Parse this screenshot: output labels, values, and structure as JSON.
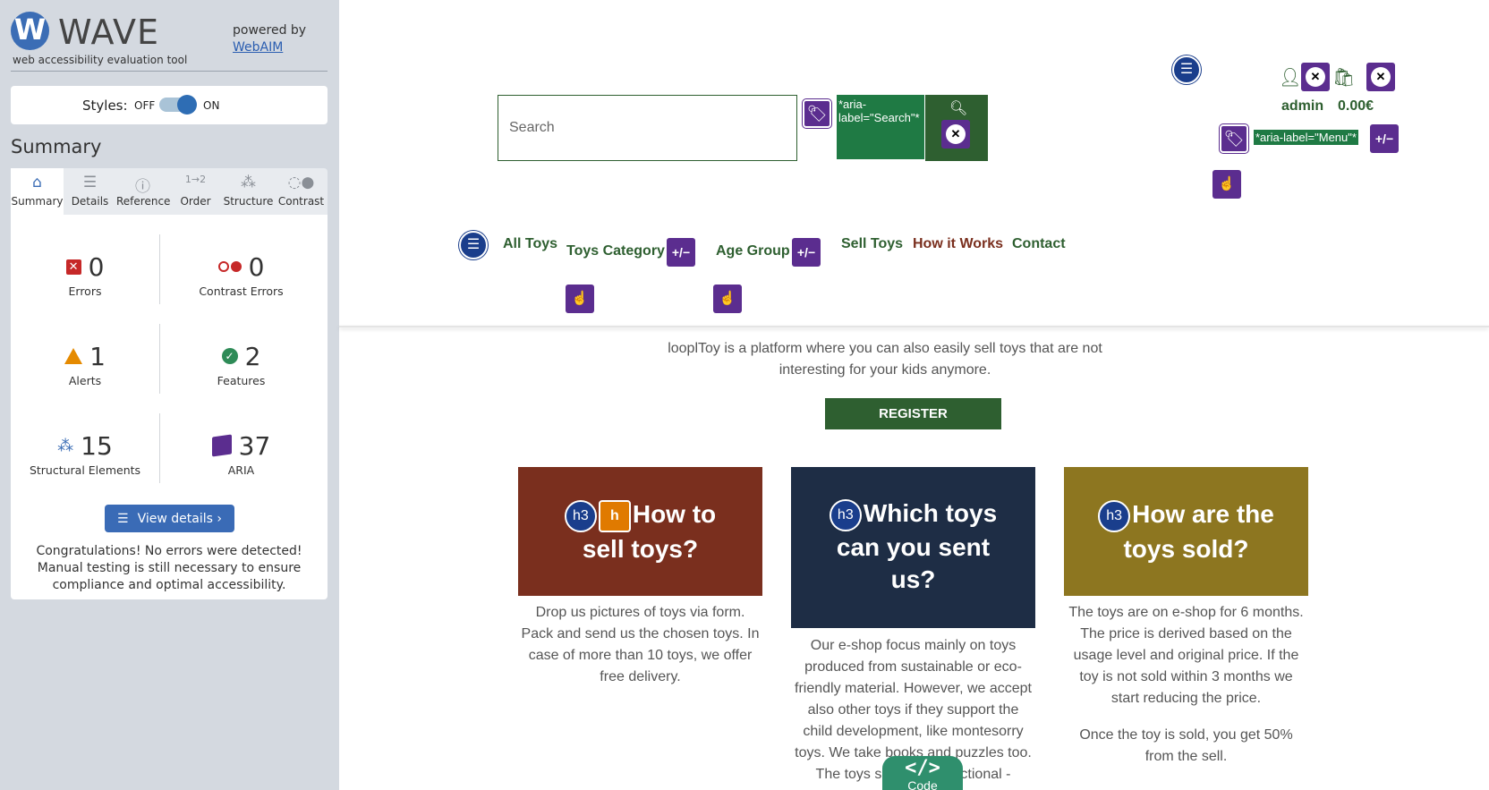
{
  "wave": {
    "logo_letter": "W",
    "title": "WAVE",
    "subtitle": "web accessibility evaluation tool",
    "powered_by": "powered by",
    "webaim_link": "WebAIM",
    "styles_label": "Styles:",
    "styles_off": "OFF",
    "styles_on": "ON",
    "summary_heading": "Summary",
    "tabs": [
      {
        "label": "Summary",
        "icon": "home-icon",
        "active": true
      },
      {
        "label": "Details",
        "icon": "list-icon"
      },
      {
        "label": "Reference",
        "icon": "info-icon"
      },
      {
        "label": "Order",
        "icon": "order-icon"
      },
      {
        "label": "Structure",
        "icon": "structure-icon"
      },
      {
        "label": "Contrast",
        "icon": "contrast-icon"
      }
    ],
    "stats": {
      "errors": {
        "count": "0",
        "label": "Errors"
      },
      "contrast_errors": {
        "count": "0",
        "label": "Contrast Errors"
      },
      "alerts": {
        "count": "1",
        "label": "Alerts"
      },
      "features": {
        "count": "2",
        "label": "Features"
      },
      "structural": {
        "count": "15",
        "label": "Structural Elements"
      },
      "aria": {
        "count": "37",
        "label": "ARIA"
      }
    },
    "view_details": "View details ›",
    "congrats": "Congratulations! No errors were detected! Manual testing is still necessary to ensure compliance and optimal accessibility."
  },
  "site": {
    "search_placeholder": "Search",
    "aria_search": "*aria-label=\"Search\"*",
    "aria_menu": "*aria-label=\"Menu\"*",
    "account_name": "admin",
    "cart_price": "0.00€",
    "nav": {
      "all_toys": "All Toys",
      "toys_category": "Toys Category",
      "age_group": "Age Group",
      "sell_toys": "Sell Toys",
      "how_it_works": "How it Works",
      "contact": "Contact"
    },
    "pm_label": "+/−",
    "intro": "looplToy is a platform where you can also easily sell toys that are not interesting for your kids anymore.",
    "register": "REGISTER",
    "h3_badge": "h3",
    "h_badge": "h",
    "cards": [
      {
        "title_line1": "How to",
        "title_line2": "sell toys?",
        "text": "Drop us pictures of toys via form. Pack and send us the chosen toys. In case of more than 10 toys, we offer free delivery.",
        "color": "#7a2f1e"
      },
      {
        "title_line1": "Which toys",
        "title_line2": "can you sent",
        "title_line3": "us?",
        "text": "Our e-shop focus mainly on toys produced from sustainable or eco-friendly material. However, we accept also other toys if they support the child development, like montesorry toys. We take books and puzzles too. The toys should be functional -",
        "color": "#1e2d45"
      },
      {
        "title_line1": "How are the",
        "title_line2": "toys sold?",
        "text": "The toys are on e-shop for 6 months. The price is derived based on the usage level and original price. If the toy is not sold within 3 months we start reducing the price.",
        "text2": "Once the toy is sold, you get 50% from the sell.",
        "color": "#8d7620"
      }
    ],
    "code_tab": {
      "glyph": "</>",
      "label": "Code"
    }
  }
}
